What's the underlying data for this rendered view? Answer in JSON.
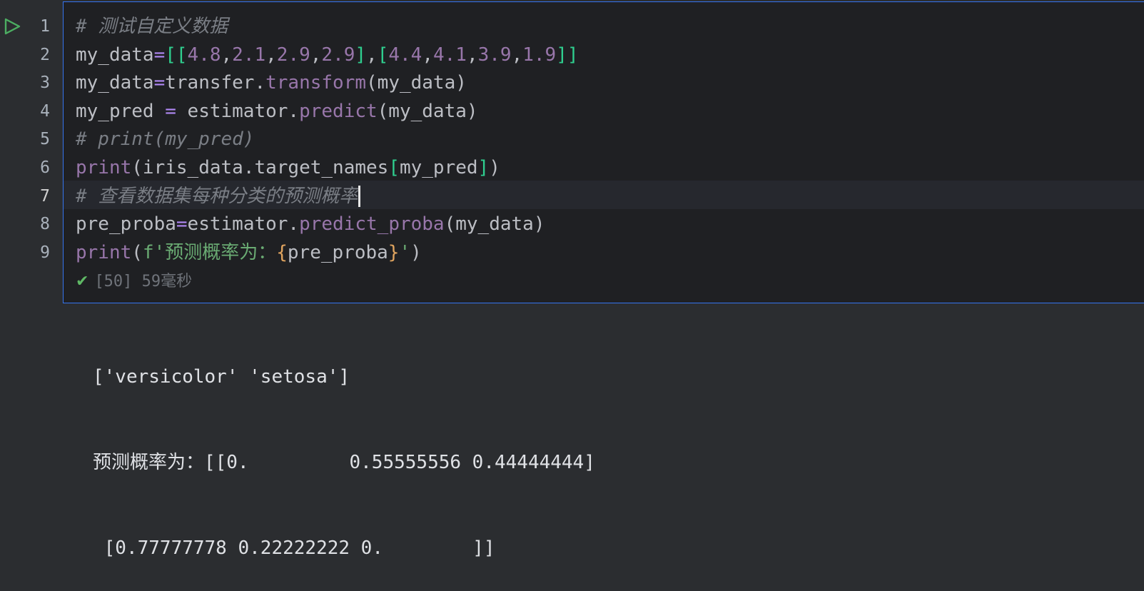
{
  "cell": {
    "lines": [
      {
        "num": "1",
        "parts": [
          {
            "t": "# 测试自定义数据",
            "c": "cmt"
          }
        ]
      },
      {
        "num": "2",
        "parts": [
          {
            "t": "my_data",
            "c": "punc"
          },
          {
            "t": "=",
            "c": "fn"
          },
          {
            "t": "[[",
            "c": "brk"
          },
          {
            "t": "4.8",
            "c": "num-lit"
          },
          {
            "t": ",",
            "c": "punc"
          },
          {
            "t": "2.1",
            "c": "num-lit"
          },
          {
            "t": ",",
            "c": "punc"
          },
          {
            "t": "2.9",
            "c": "num-lit"
          },
          {
            "t": ",",
            "c": "punc"
          },
          {
            "t": "2.9",
            "c": "num-lit"
          },
          {
            "t": "]",
            "c": "brk"
          },
          {
            "t": ",",
            "c": "punc"
          },
          {
            "t": "[",
            "c": "brk"
          },
          {
            "t": "4.4",
            "c": "num-lit"
          },
          {
            "t": ",",
            "c": "punc"
          },
          {
            "t": "4.1",
            "c": "num-lit"
          },
          {
            "t": ",",
            "c": "punc"
          },
          {
            "t": "3.9",
            "c": "num-lit"
          },
          {
            "t": ",",
            "c": "punc"
          },
          {
            "t": "1.9",
            "c": "num-lit"
          },
          {
            "t": "]]",
            "c": "brk"
          }
        ]
      },
      {
        "num": "3",
        "parts": [
          {
            "t": "my_data",
            "c": "punc"
          },
          {
            "t": "=",
            "c": "fn"
          },
          {
            "t": "transfer.",
            "c": "punc"
          },
          {
            "t": "transform",
            "c": "fn2"
          },
          {
            "t": "(my_data)",
            "c": "punc"
          }
        ]
      },
      {
        "num": "4",
        "parts": [
          {
            "t": "my_pred ",
            "c": "punc"
          },
          {
            "t": "=",
            "c": "fn"
          },
          {
            "t": " estimator.",
            "c": "punc"
          },
          {
            "t": "predict",
            "c": "fn2"
          },
          {
            "t": "(my_data)",
            "c": "punc"
          }
        ]
      },
      {
        "num": "5",
        "parts": [
          {
            "t": "# print(my_pred)",
            "c": "cmt"
          }
        ]
      },
      {
        "num": "6",
        "parts": [
          {
            "t": "print",
            "c": "fn2"
          },
          {
            "t": "(iris_data.target_names",
            "c": "punc"
          },
          {
            "t": "[",
            "c": "brk"
          },
          {
            "t": "my_pred",
            "c": "punc"
          },
          {
            "t": "]",
            "c": "brk"
          },
          {
            "t": ")",
            "c": "punc"
          }
        ]
      },
      {
        "num": "7",
        "current": true,
        "parts": [
          {
            "t": "# 查看数据集每种分类的预测概率",
            "c": "cmt"
          }
        ]
      },
      {
        "num": "8",
        "parts": [
          {
            "t": "pre_proba",
            "c": "punc"
          },
          {
            "t": "=",
            "c": "fn"
          },
          {
            "t": "estimator.",
            "c": "punc"
          },
          {
            "t": "predict_proba",
            "c": "fn2"
          },
          {
            "t": "(my_data)",
            "c": "punc"
          }
        ]
      },
      {
        "num": "9",
        "parts": [
          {
            "t": "print",
            "c": "fn2"
          },
          {
            "t": "(",
            "c": "punc"
          },
          {
            "t": "f'预测概率为：",
            "c": "str"
          },
          {
            "t": "{",
            "c": "brace"
          },
          {
            "t": "pre_proba",
            "c": "punc"
          },
          {
            "t": "}",
            "c": "brace"
          },
          {
            "t": "'",
            "c": "str"
          },
          {
            "t": ")",
            "c": "punc"
          }
        ]
      }
    ],
    "status": {
      "count": "[50]",
      "time": "59毫秒"
    }
  },
  "output": {
    "lines": [
      "['versicolor' 'setosa']",
      "预测概率为：[[0.         0.55555556 0.44444444]",
      " [0.77777778 0.22222222 0.        ]]"
    ]
  },
  "colors": {
    "background": "#2b2d30",
    "cell_background": "#1f2023",
    "run_icon": "#4cae62",
    "check_icon": "#5fb865"
  },
  "icons": {
    "run": "run-icon",
    "check": "check-icon"
  }
}
